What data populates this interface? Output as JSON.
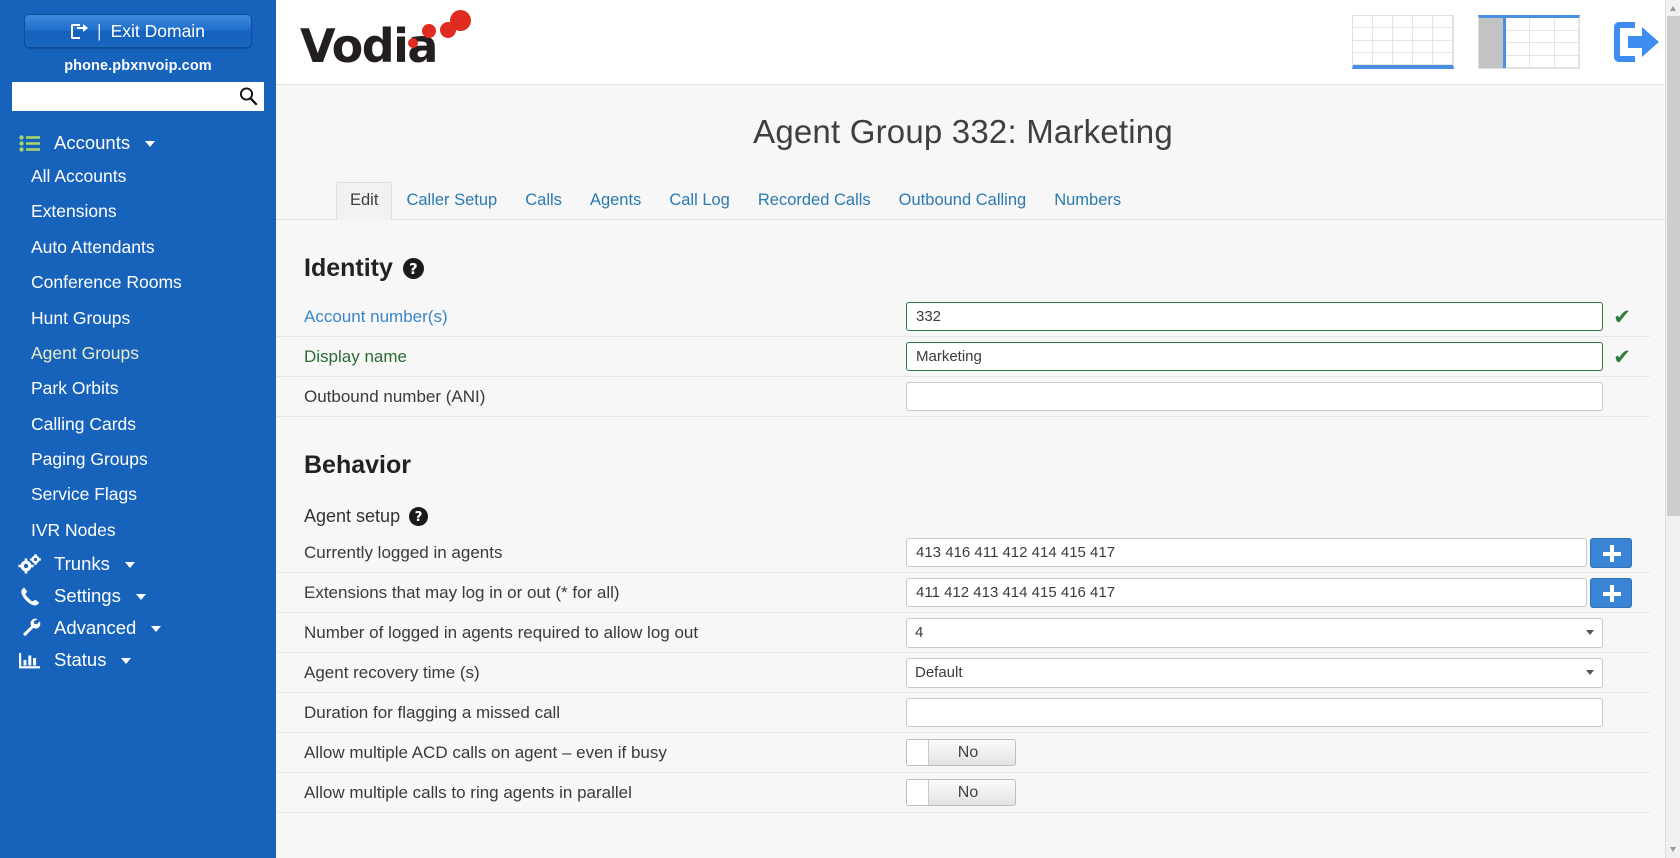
{
  "sidebar": {
    "exit_domain_label": "Exit Domain",
    "exit_domain_separator": "|",
    "domain_name": "phone.pbxnvoip.com",
    "search_placeholder": "",
    "search_value": "",
    "groups": [
      {
        "label": "Accounts",
        "icon": "list-icon",
        "items": [
          {
            "label": "All Accounts",
            "active": false
          },
          {
            "label": "Extensions",
            "active": false
          },
          {
            "label": "Auto Attendants",
            "active": false
          },
          {
            "label": "Conference Rooms",
            "active": false
          },
          {
            "label": "Hunt Groups",
            "active": false
          },
          {
            "label": "Agent Groups",
            "active": true
          },
          {
            "label": "Park Orbits",
            "active": false
          },
          {
            "label": "Calling Cards",
            "active": false
          },
          {
            "label": "Paging Groups",
            "active": false
          },
          {
            "label": "Service Flags",
            "active": false
          },
          {
            "label": "IVR Nodes",
            "active": false
          }
        ]
      },
      {
        "label": "Trunks",
        "icon": "gears-icon",
        "items": []
      },
      {
        "label": "Settings",
        "icon": "phone-icon",
        "items": []
      },
      {
        "label": "Advanced",
        "icon": "wrench-icon",
        "items": []
      },
      {
        "label": "Status",
        "icon": "bar-chart-icon",
        "items": []
      }
    ]
  },
  "header": {
    "logo_text": "Vodia",
    "grid_view_icon": "grid-layout-icon",
    "split_view_icon": "split-layout-icon",
    "logout_icon": "logout-icon"
  },
  "page": {
    "title": "Agent Group 332: Marketing",
    "tabs": [
      {
        "label": "Edit",
        "active": true
      },
      {
        "label": "Caller Setup",
        "active": false
      },
      {
        "label": "Calls",
        "active": false
      },
      {
        "label": "Agents",
        "active": false
      },
      {
        "label": "Call Log",
        "active": false
      },
      {
        "label": "Recorded Calls",
        "active": false
      },
      {
        "label": "Outbound Calling",
        "active": false
      },
      {
        "label": "Numbers",
        "active": false
      }
    ]
  },
  "identity": {
    "heading": "Identity",
    "help_glyph": "?",
    "rows": [
      {
        "label": "Account number(s)",
        "label_style": "link",
        "type": "text",
        "value": "332",
        "valid": true,
        "check_glyph": "✔"
      },
      {
        "label": "Display name",
        "label_style": "green",
        "type": "text",
        "value": "Marketing",
        "valid": true,
        "check_glyph": "✔"
      },
      {
        "label": "Outbound number (ANI)",
        "label_style": "plain",
        "type": "text",
        "value": "",
        "valid": false,
        "check_glyph": ""
      }
    ]
  },
  "behavior": {
    "heading": "Behavior",
    "subheading": "Agent setup",
    "help_glyph": "?",
    "rows": [
      {
        "label": "Currently logged in agents",
        "type": "text-plus",
        "value": "413 416 411 412 414 415 417",
        "plus_label": "+"
      },
      {
        "label": "Extensions that may log in or out (* for all)",
        "type": "text-plus",
        "value": "411 412 413 414 415 416 417",
        "plus_label": "+"
      },
      {
        "label": "Number of logged in agents required to allow log out",
        "type": "select",
        "value": "4"
      },
      {
        "label": "Agent recovery time (s)",
        "type": "select",
        "value": "Default"
      },
      {
        "label": "Duration for flagging a missed call",
        "type": "text",
        "value": ""
      },
      {
        "label": "Allow multiple ACD calls on agent – even if busy",
        "type": "toggle",
        "value": "No"
      },
      {
        "label": "Allow multiple calls to ring agents in parallel",
        "type": "toggle",
        "value": "No"
      }
    ]
  },
  "colors": {
    "sidebar_blue": "#1762bb",
    "accent_blue": "#3a84d6",
    "valid_green": "#2f7a3c",
    "link_blue": "#3a86c8",
    "logo_red": "#e02b20"
  }
}
